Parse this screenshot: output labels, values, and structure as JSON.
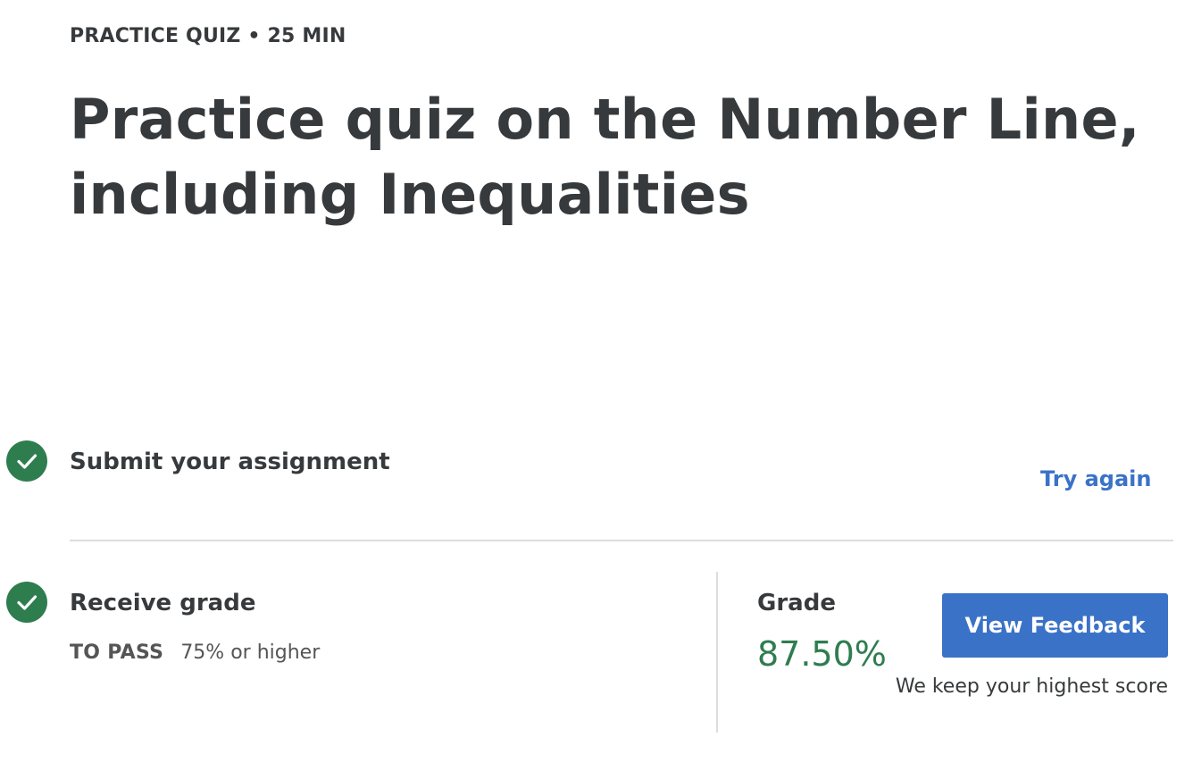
{
  "header": {
    "eyebrow": "PRACTICE QUIZ • 25 MIN",
    "title": "Practice quiz on the Number Line, including Inequalities"
  },
  "steps": {
    "submit": {
      "icon": "checkmark-icon",
      "label": "Submit your assignment",
      "action_label": "Try again"
    },
    "receive": {
      "icon": "checkmark-icon",
      "label": "Receive grade",
      "pass_label": "TO PASS",
      "pass_value": "75% or higher"
    }
  },
  "grade": {
    "label": "Grade",
    "value": "87.50%",
    "button_label": "View Feedback",
    "note": "We keep your highest score"
  },
  "colors": {
    "success": "#2e7d4f",
    "link": "#3a72c7",
    "button": "#3a72c7",
    "text": "#373a3c",
    "divider": "#dddddd"
  }
}
